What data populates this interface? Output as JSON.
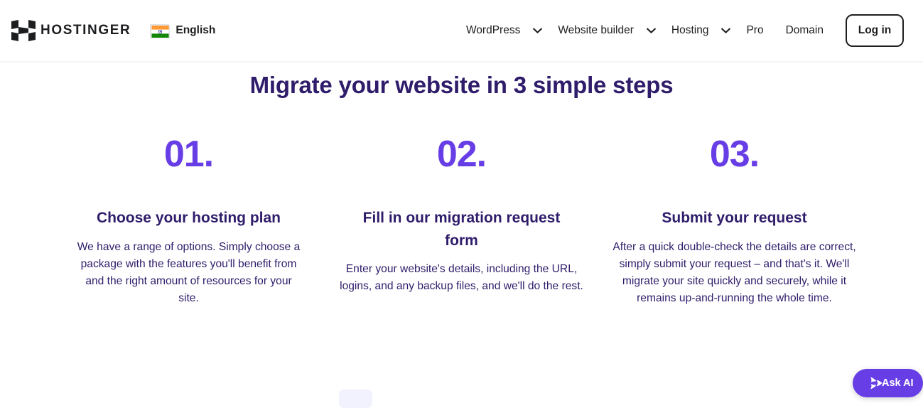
{
  "header": {
    "logo_icon": "hostinger-h-logo",
    "brand_name": "HOSTINGER",
    "language": {
      "flag_icon": "india-flag-icon",
      "label": "English"
    },
    "nav": [
      {
        "label": "WordPress",
        "has_dropdown": true,
        "icon": "chevron-down-icon"
      },
      {
        "label": "Website builder",
        "has_dropdown": true,
        "icon": "chevron-down-icon"
      },
      {
        "label": "Hosting",
        "has_dropdown": true,
        "icon": "chevron-down-icon"
      },
      {
        "label": "Pro",
        "has_dropdown": false
      },
      {
        "label": "Domain",
        "has_dropdown": false
      }
    ],
    "login_label": "Log in"
  },
  "main": {
    "title": "Migrate your website in 3 simple steps",
    "steps": [
      {
        "number": "01.",
        "title": "Choose your hosting plan",
        "body": "We have a range of options. Simply choose a package with the features you'll benefit from and the right amount of resources for your site."
      },
      {
        "number": "02.",
        "title": "Fill in our migration request form",
        "body": "Enter your website's details, including the URL, logins, and any backup files, and we'll do the rest."
      },
      {
        "number": "03.",
        "title": "Submit your request",
        "body": "After a quick double-check the details are correct, simply submit your request – and that's it. We'll migrate your site quickly and securely, while it remains up-and-running the whole time."
      }
    ]
  },
  "ask_ai": {
    "label": "Ask AI",
    "icon": "sparkle-ai-icon"
  },
  "colors": {
    "brand_purple": "#673de6",
    "heading_indigo": "#2f1c6a",
    "text_dark": "#1d1e20",
    "page_background": "#ffffff",
    "chip_lavender": "#f1f2fd"
  }
}
